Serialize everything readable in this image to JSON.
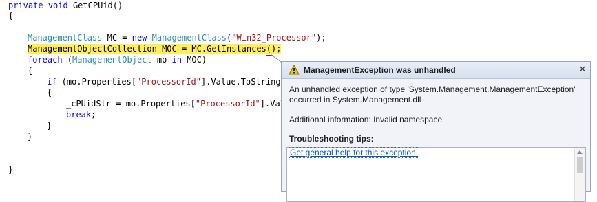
{
  "code": {
    "l1_kw1": "private",
    "l1_kw2": "void",
    "l1_rest": " GetCPUid()",
    "l2": "{",
    "l4_type1": "ManagementClass",
    "l4_mid": " MC = ",
    "l4_kw": "new",
    "l4_type2": "ManagementClass",
    "l4_open": "(",
    "l4_str": "\"Win32_Processor\"",
    "l4_close": ");",
    "l5_type": "ManagementObjectCollection",
    "l5_rest": " MOC = MC.GetInstances();",
    "l6_kw1": "foreach",
    "l6_open": " (",
    "l6_type": "ManagementObject",
    "l6_mid": " mo ",
    "l6_kw2": "in",
    "l6_rest": " MOC)",
    "l7": "{",
    "l8_kw": "if",
    "l8_a": " (mo.Properties[",
    "l8_str": "\"ProcessorId\"",
    "l8_b": "].Value.ToString()",
    "l9": "{",
    "l10_a": "_cPUidStr = mo.Properties[",
    "l10_str": "\"ProcessorId\"",
    "l10_b": "].Valu",
    "l11_kw": "break",
    "l11_rest": ";",
    "l12": "}",
    "l13": "}",
    "l16": "}"
  },
  "popup": {
    "title": "ManagementException was unhandled",
    "close": "✕",
    "message_line1": "An unhandled exception of type 'System.Management.ManagementException'",
    "message_line2": "occurred in System.Management.dll",
    "additional": "Additional information: Invalid namespace",
    "tips_title": "Troubleshooting tips:",
    "tip_link": "Get general help for this exception."
  },
  "colors": {
    "keyword": "#0000ff",
    "type": "#2b91af",
    "string": "#a31515",
    "highlight": "#ffef5c",
    "link": "#0055cc"
  },
  "icons": {
    "warning": "warning-icon",
    "close": "close-icon"
  }
}
